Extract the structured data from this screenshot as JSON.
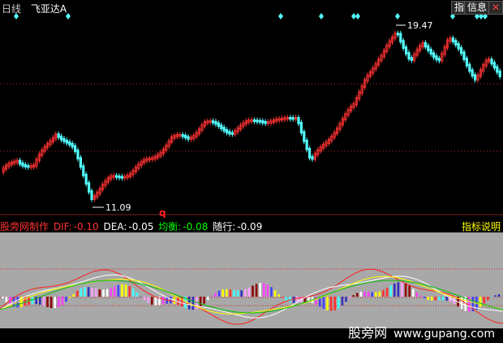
{
  "header": {
    "period": "日线",
    "stock": "飞亚达A"
  },
  "toolbar": {
    "btn_zhi": "指",
    "btn_info": "信息",
    "btn_close": "✕"
  },
  "price_labels": {
    "high": "19.47",
    "low": "11.09",
    "marker": "q"
  },
  "indicator": {
    "name": "股旁网制作",
    "dif_label": "DIF:",
    "dif_value": "-0.10",
    "dea_label": "DEA:",
    "dea_value": "-0.05",
    "avg_label": "均衡:",
    "avg_value": "-0.08",
    "follow_label": "随行:",
    "follow_value": "-0.09",
    "help": "指标说明"
  },
  "watermark": {
    "cn": "股旁网",
    "url": "www.gupang.com"
  },
  "colors": {
    "up": "#ff3232",
    "down": "#54ffff",
    "diamond": "#54ffff",
    "grid": "#b42828",
    "panel_bg": "#a8a8a8"
  }
}
